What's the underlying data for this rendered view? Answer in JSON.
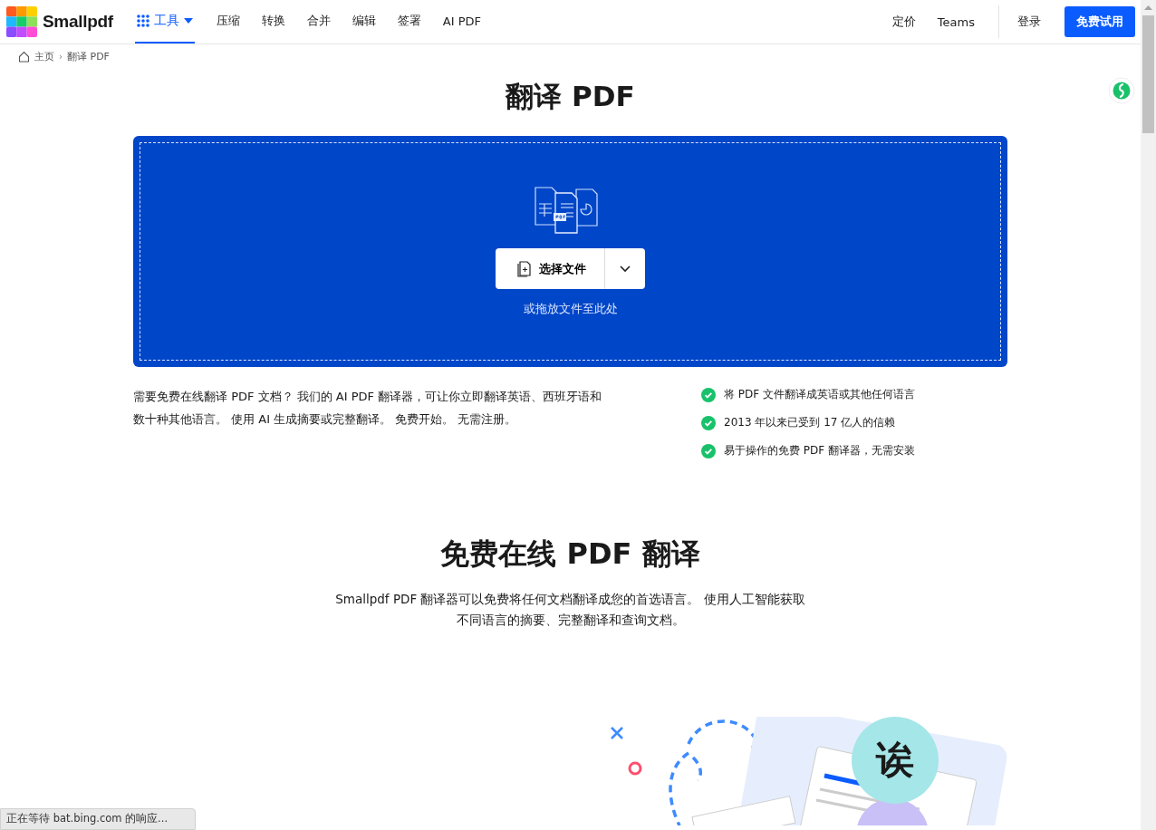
{
  "brand": {
    "name": "Smallpdf"
  },
  "nav": {
    "items": [
      {
        "label": "工具",
        "kind": "menu",
        "selected": true
      },
      {
        "label": "压缩",
        "kind": "link",
        "selected": false
      },
      {
        "label": "转换",
        "kind": "link",
        "selected": false
      },
      {
        "label": "合并",
        "kind": "link",
        "selected": false
      },
      {
        "label": "编辑",
        "kind": "link",
        "selected": false
      },
      {
        "label": "签署",
        "kind": "link",
        "selected": false
      },
      {
        "label": "AI PDF",
        "kind": "link",
        "selected": false
      }
    ],
    "right_links": [
      "定价",
      "Teams"
    ],
    "login": "登录",
    "cta": "免费试用"
  },
  "breadcrumb": {
    "items": [
      "主页",
      "翻译 PDF"
    ],
    "separator": "›"
  },
  "title": "翻译 PDF",
  "upload": {
    "button": "选择文件",
    "hint": "或拖放文件至此处"
  },
  "intro": "需要免费在线翻译 PDF 文档？ 我们的 AI PDF 翻译器，可让你立即翻译英语、西班牙语和数十种其他语言。 使用 AI 生成摘要或完整翻译。 免费开始。 无需注册。",
  "features": [
    "将 PDF 文件翻译成英语或其他任何语言",
    "2013 年以来已受到 17 亿人的信赖",
    "易于操作的免费 PDF 翻译器，无需安装"
  ],
  "section": {
    "title": "免费在线 PDF 翻译",
    "text": "Smallpdf PDF 翻译器可以免费将任何文档翻译成您的首选语言。 使用人工智能获取不同语言的摘要、完整翻译和查询文档。",
    "illustration_glyph": "诶"
  },
  "status_bar": "正在等待 bat.bing.com 的响应..."
}
